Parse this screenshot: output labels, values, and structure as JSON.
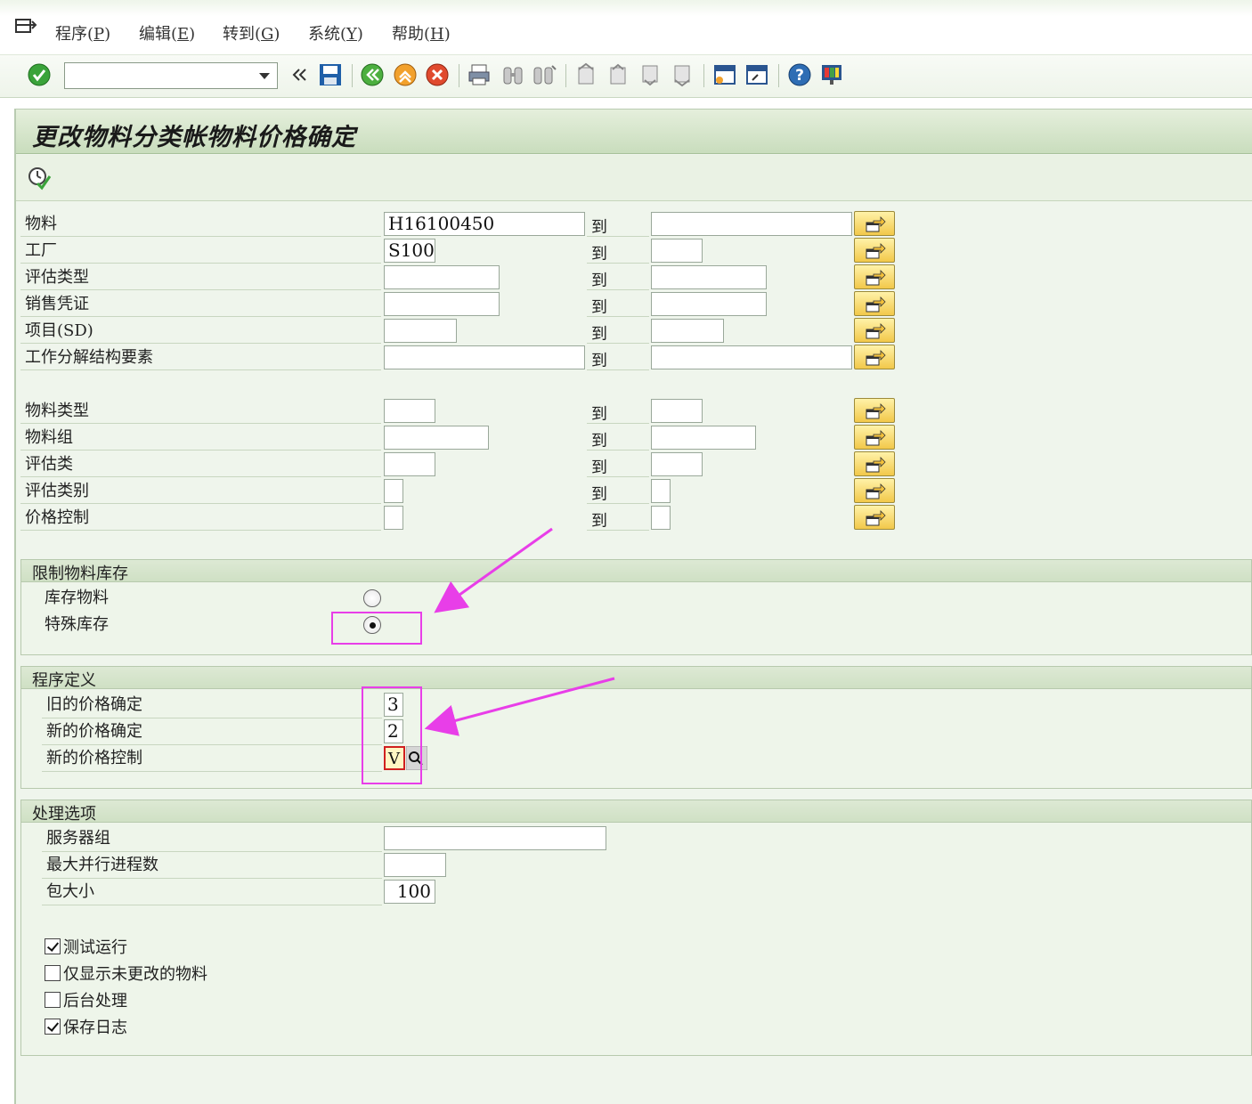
{
  "menu": {
    "items": [
      {
        "label": "程序(",
        "key": "P",
        "close": ")"
      },
      {
        "label": "编辑(",
        "key": "E",
        "close": ")"
      },
      {
        "label": "转到(",
        "key": "G",
        "close": ")"
      },
      {
        "label": "系统(",
        "key": "Y",
        "close": ")"
      },
      {
        "label": "帮助(",
        "key": "H",
        "close": ")"
      }
    ]
  },
  "toolbar": {
    "command_value": "",
    "icons": [
      "enter-icon",
      "command-dropdown",
      "collapse-icon",
      "save-icon",
      "back-icon",
      "exit-icon",
      "cancel-icon",
      "print-icon",
      "find-icon",
      "find-next-icon",
      "first-page-icon",
      "prev-page-icon",
      "next-page-icon",
      "last-page-icon",
      "new-session-icon",
      "shortcut-icon",
      "help-icon",
      "layout-icon"
    ]
  },
  "title": "更改物料分类帐物料价格确定",
  "to_label": "到",
  "selection": {
    "rows": [
      {
        "label": "物料",
        "from": "H16100450",
        "to": ""
      },
      {
        "label": "工厂",
        "from": "S100",
        "to": ""
      },
      {
        "label": "评估类型",
        "from": "",
        "to": ""
      },
      {
        "label": "销售凭证",
        "from": "",
        "to": ""
      },
      {
        "label": "项目(SD)",
        "from": "",
        "to": ""
      },
      {
        "label": "工作分解结构要素",
        "from": "",
        "to": ""
      },
      {
        "label": "物料类型",
        "from": "",
        "to": ""
      },
      {
        "label": "物料组",
        "from": "",
        "to": ""
      },
      {
        "label": "评估类",
        "from": "",
        "to": ""
      },
      {
        "label": "评估类别",
        "from": "",
        "to": ""
      },
      {
        "label": "价格控制",
        "from": "",
        "to": ""
      }
    ]
  },
  "stock_group": {
    "title": "限制物料库存",
    "options": [
      {
        "label": "库存物料",
        "selected": false
      },
      {
        "label": "特殊库存",
        "selected": true
      }
    ]
  },
  "program_group": {
    "title": "程序定义",
    "old_price_label": "旧的价格确定",
    "old_price_value": "3",
    "new_price_label": "新的价格确定",
    "new_price_value": "2",
    "new_control_label": "新的价格控制",
    "new_control_value": "V"
  },
  "processing_group": {
    "title": "处理选项",
    "server_group_label": "服务器组",
    "server_group_value": "",
    "max_proc_label": "最大并行进程数",
    "max_proc_value": "",
    "package_label": "包大小",
    "package_value": "100"
  },
  "checkboxes": [
    {
      "label": "测试运行",
      "checked": true
    },
    {
      "label": "仅显示未更改的物料",
      "checked": false
    },
    {
      "label": "后台处理",
      "checked": false
    },
    {
      "label": "保存日志",
      "checked": true
    }
  ],
  "colors": {
    "accent_arrow": "#e83ee8",
    "frame_green": "#c9ddbd",
    "multi_select_yellow": "#f2c84a"
  }
}
